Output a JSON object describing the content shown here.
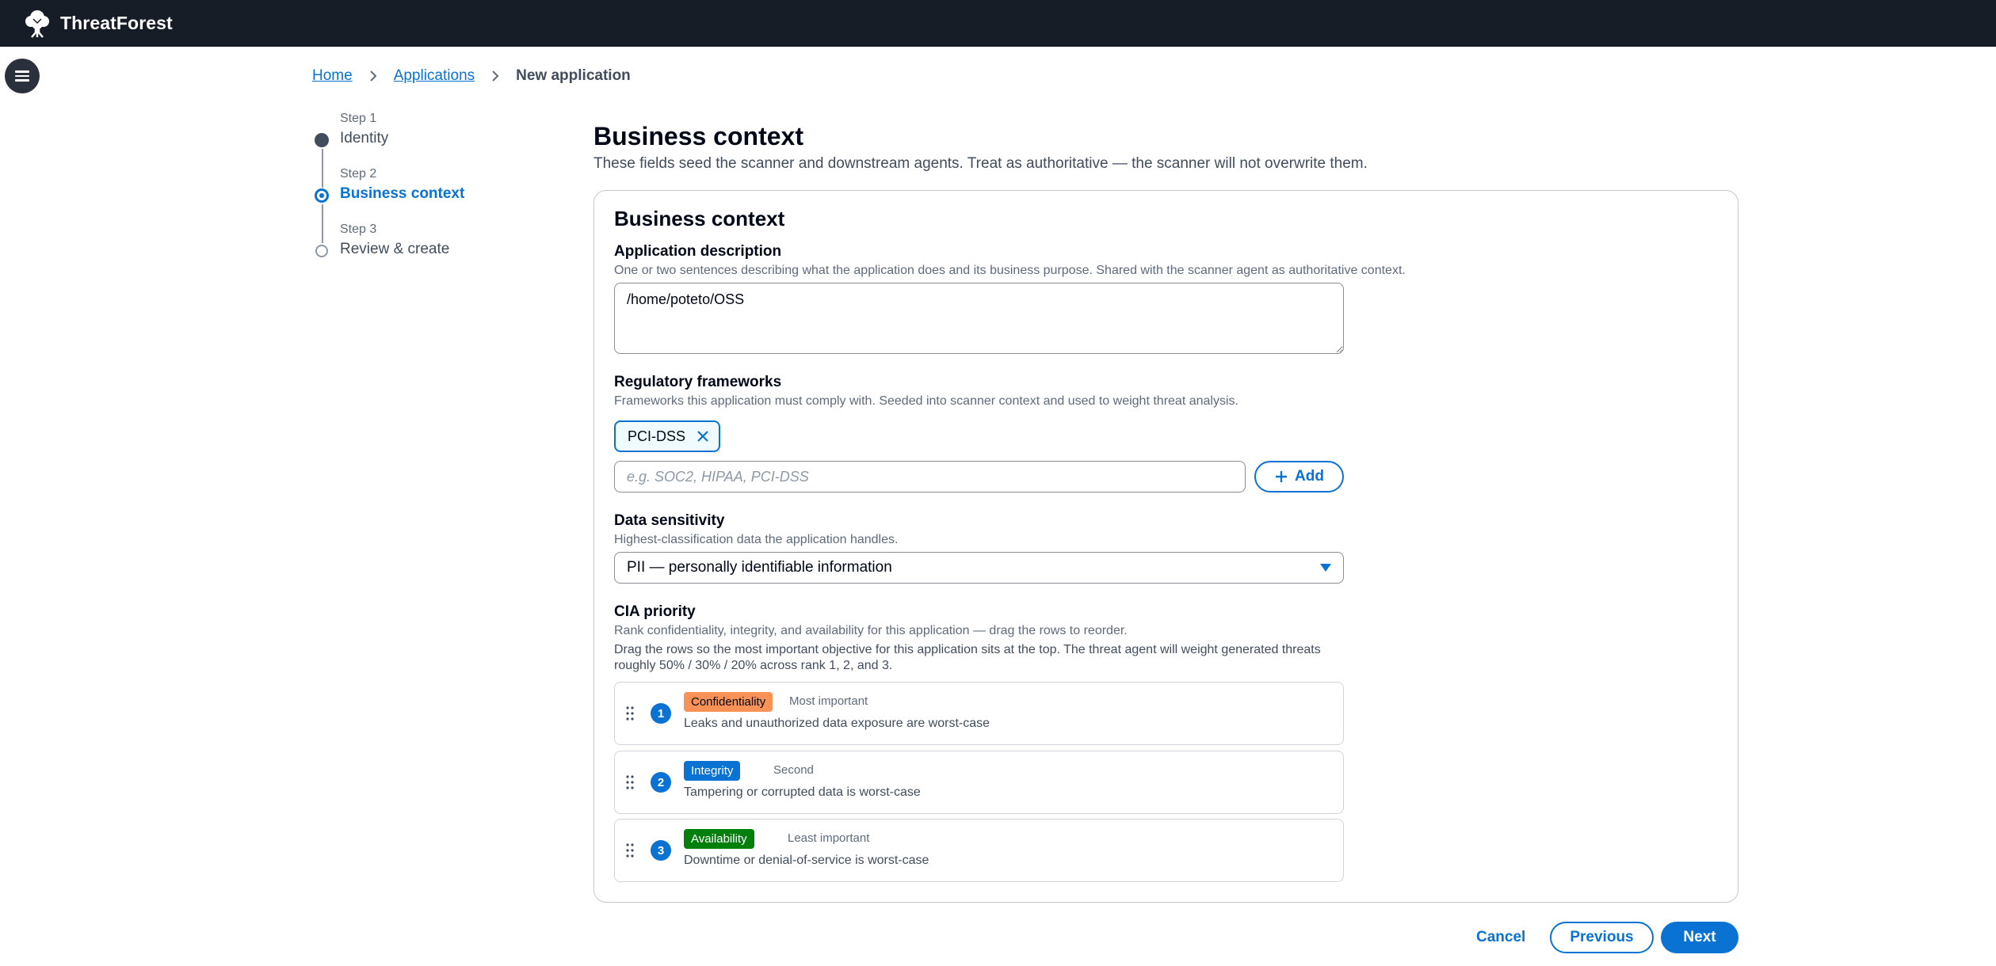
{
  "app": {
    "brand": "ThreatForest",
    "logo_icon": "tree-icon"
  },
  "breadcrumb": {
    "home": "Home",
    "applications": "Applications",
    "current": "New application"
  },
  "steps": [
    {
      "num": "Step 1",
      "title": "Identity",
      "state": "done"
    },
    {
      "num": "Step 2",
      "title": "Business context",
      "state": "active"
    },
    {
      "num": "Step 3",
      "title": "Review & create",
      "state": "todo"
    }
  ],
  "header": {
    "title": "Business context",
    "description": "These fields seed the scanner and downstream agents. Treat as authoritative — the scanner will not overwrite them."
  },
  "form": {
    "title": "Business context",
    "app_description": {
      "label": "Application description",
      "hint": "One or two sentences describing what the application does and its business purpose. Shared with the scanner agent as authoritative context.",
      "value": "/home/poteto/OSS"
    },
    "frameworks": {
      "label": "Regulatory frameworks",
      "hint": "Frameworks this application must comply with. Seeded into scanner context and used to weight threat analysis.",
      "tokens": [
        "PCI-DSS"
      ],
      "placeholder": "e.g. SOC2, HIPAA, PCI-DSS",
      "add_label": "Add"
    },
    "sensitivity": {
      "label": "Data sensitivity",
      "hint": "Highest-classification data the application handles.",
      "selected": "PII — personally identifiable information"
    },
    "cia": {
      "label": "CIA priority",
      "hint": "Rank confidentiality, integrity, and availability for this application — drag the rows to reorder.",
      "note": "Drag the rows so the most important objective for this application sits at the top. The threat agent will weight generated threats roughly 50% / 30% / 20% across rank 1, 2, and 3.",
      "rows": [
        {
          "rank": "1",
          "name": "Confidentiality",
          "importance": "Most important",
          "desc": "Leaks and unauthorized data exposure are worst-case",
          "color": "#f89256",
          "text_color": "#000716"
        },
        {
          "rank": "2",
          "name": "Integrity",
          "importance": "Second",
          "desc": "Tampering or corrupted data is worst-case",
          "color": "#0972d3",
          "text_color": "#ffffff"
        },
        {
          "rank": "3",
          "name": "Availability",
          "importance": "Least important",
          "desc": "Downtime or denial-of-service is worst-case",
          "color": "#037f0c",
          "text_color": "#ffffff"
        }
      ]
    }
  },
  "footer": {
    "cancel": "Cancel",
    "previous": "Previous",
    "next": "Next"
  },
  "colors": {
    "topbar": "#161d26",
    "accent": "#0972d3"
  }
}
